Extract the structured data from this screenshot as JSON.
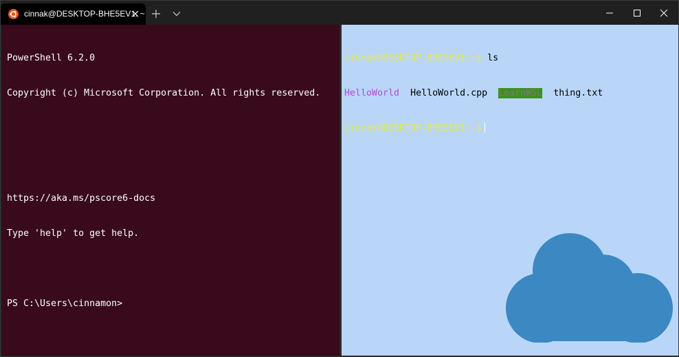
{
  "window": {
    "tab": {
      "title": "cinnak@DESKTOP-BHE5EV1: ~",
      "icon": "ubuntu-icon"
    },
    "controls": {
      "new_tab": "plus-icon",
      "dropdown": "chevron-down-icon",
      "minimize": "minimize-icon",
      "maximize": "maximize-icon",
      "close": "close-icon"
    },
    "colors": {
      "titlebar": "#202020",
      "tab_active": "#000000",
      "left_pane_bg": "#380a1b",
      "right_pane_bg": "#b9d6f8",
      "prompt": "#e8e84a",
      "executable": "#b64ad6",
      "directory_bg": "#3f8f1f",
      "cloud": "#3b88c3"
    }
  },
  "left_pane": {
    "lines": [
      "PowerShell 6.2.0",
      "Copyright (c) Microsoft Corporation. All rights reserved.",
      "",
      "",
      "https://aka.ms/pscore6-docs",
      "Type 'help' to get help.",
      "",
      "PS C:\\Users\\cinnamon>"
    ]
  },
  "right_pane": {
    "prompt": "cinnak@DESKTOP-BHE5EV1:~$",
    "command": " ls",
    "listing": {
      "item1": "HelloWorld",
      "item2": "HelloWorld.cpp",
      "item3": "LearnWSL",
      "item4": "thing.txt"
    },
    "prompt2": "cinnak@DESKTOP-BHE5EV1:~$",
    "background_image": "cloud-icon"
  }
}
